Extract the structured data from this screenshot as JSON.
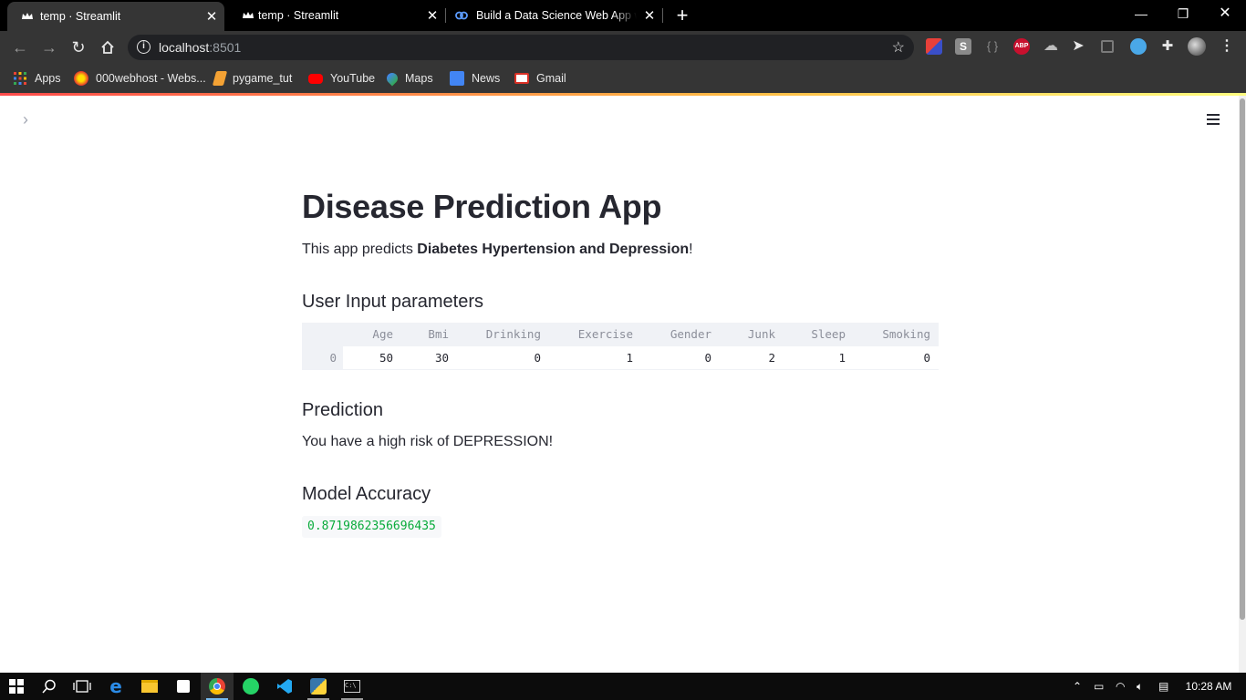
{
  "browser": {
    "tabs": [
      {
        "title": "temp · Streamlit",
        "active": true
      },
      {
        "title": "temp · Streamlit",
        "active": false
      },
      {
        "title": "Build a Data Science Web App wi",
        "active": false
      }
    ],
    "url_host": "localhost",
    "url_port": ":8501",
    "bookmarks": [
      {
        "label": "Apps",
        "icon": "apps-grid-icon"
      },
      {
        "label": "000webhost - Webs...",
        "icon": "webhost-icon"
      },
      {
        "label": "pygame_tut",
        "icon": "bookmark-folder-icon"
      },
      {
        "label": "YouTube",
        "icon": "youtube-icon"
      },
      {
        "label": "Maps",
        "icon": "maps-icon"
      },
      {
        "label": "News",
        "icon": "news-icon"
      },
      {
        "label": "Gmail",
        "icon": "gmail-icon"
      }
    ],
    "extensions": [
      "extension-red-icon",
      "extension-s-icon",
      "extension-braces-icon",
      "adblock-plus-icon",
      "extension-cloud-icon",
      "extension-cursor-icon",
      "extension-window-icon",
      "extension-blue-icon",
      "puzzle-icon",
      "profile-avatar-icon"
    ]
  },
  "app": {
    "title": "Disease Prediction App",
    "intro_prefix": "This app predicts ",
    "intro_bold": "Diabetes Hypertension and Depression",
    "intro_suffix": "!",
    "input_heading": "User Input parameters",
    "table": {
      "columns": [
        "Age",
        "Bmi",
        "Drinking",
        "Exercise",
        "Gender",
        "Junk",
        "Sleep",
        "Smoking"
      ],
      "rows": [
        {
          "index": "0",
          "values": [
            "50",
            "30",
            "0",
            "1",
            "0",
            "2",
            "1",
            "0"
          ]
        }
      ]
    },
    "prediction_heading": "Prediction",
    "prediction_text": "You have a high risk of DEPRESSION!",
    "accuracy_heading": "Model Accuracy",
    "accuracy_value": "0.8719862356696435"
  },
  "taskbar": {
    "clock": "10:28 AM",
    "apps": [
      "windows-start-icon",
      "search-icon",
      "task-view-icon",
      "edge-icon",
      "file-explorer-icon",
      "store-icon",
      "chrome-icon",
      "whatsapp-icon",
      "vscode-icon",
      "python-icon",
      "terminal-icon"
    ]
  },
  "colors": {
    "accent_code_green": "#09ab3b",
    "text_dark": "#262730",
    "table_header_bg": "#f0f2f6",
    "streamlit_gradient_start": "#ff4b4b"
  }
}
